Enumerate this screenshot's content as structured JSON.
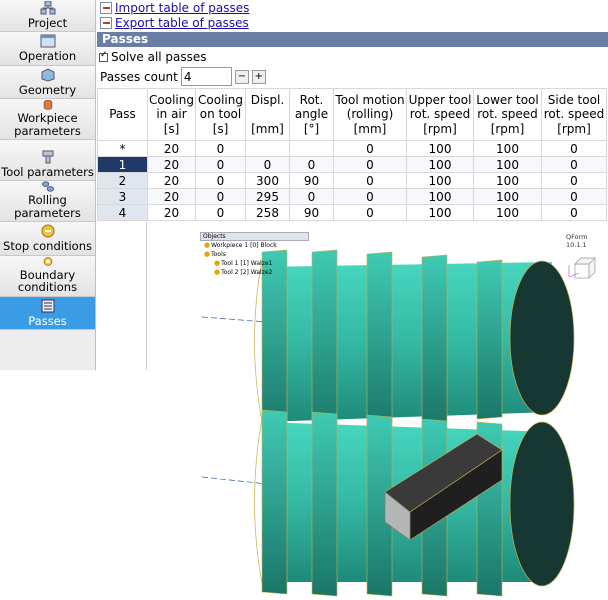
{
  "sidebar": {
    "items": [
      {
        "label": "Project",
        "icon": "project-icon"
      },
      {
        "label": "Operation",
        "icon": "operation-icon"
      },
      {
        "label": "Geometry",
        "icon": "geometry-icon"
      },
      {
        "label": "Workpiece parameters",
        "icon": "workpiece-icon"
      },
      {
        "label": "Tool parameters",
        "icon": "tool-icon"
      },
      {
        "label": "Rolling parameters",
        "icon": "rolling-icon"
      },
      {
        "label": "Stop conditions",
        "icon": "stop-icon"
      },
      {
        "label": "Boundary conditions",
        "icon": "boundary-icon"
      },
      {
        "label": "Passes",
        "icon": "passes-icon",
        "active": true
      }
    ]
  },
  "links": {
    "import_label": "Import table of passes",
    "export_label": "Export table of passes"
  },
  "panel": {
    "title": "Passes",
    "solve_all_label": "Solve all passes",
    "solve_all_checked": true,
    "count_label": "Passes count",
    "count_value": "4",
    "minus": "−",
    "plus": "+"
  },
  "table": {
    "headers": [
      "Pass",
      "Cooling\nin air\n[s]",
      "Cooling\non tool\n[s]",
      "Displ.\n\n[mm]",
      "Rot.\nangle\n[°]",
      "Tool motion\n(rolling)\n[mm]",
      "Upper tool\nrot. speed\n[rpm]",
      "Lower tool\nrot. speed\n[rpm]",
      "Side tool\nrot. speed\n[rpm]"
    ],
    "rows": [
      [
        "*",
        "20",
        "0",
        "",
        "",
        "0",
        "100",
        "100",
        "0"
      ],
      [
        "1",
        "20",
        "0",
        "0",
        "0",
        "0",
        "100",
        "100",
        "0"
      ],
      [
        "2",
        "20",
        "0",
        "300",
        "90",
        "0",
        "100",
        "100",
        "0"
      ],
      [
        "3",
        "20",
        "0",
        "295",
        "0",
        "0",
        "100",
        "100",
        "0"
      ],
      [
        "4",
        "20",
        "0",
        "258",
        "90",
        "0",
        "100",
        "100",
        "0"
      ]
    ]
  },
  "viewport": {
    "objects_title": "Objects",
    "tree": [
      "Workpiece 1 [0] Block",
      "Tools",
      "Tool 1 [1] Walze1",
      "Tool 2 [2] Walze2"
    ],
    "version": "QForm 10.1.1",
    "roll_color": "#3bbfa8",
    "workpiece_color": "#2a2a2a"
  }
}
